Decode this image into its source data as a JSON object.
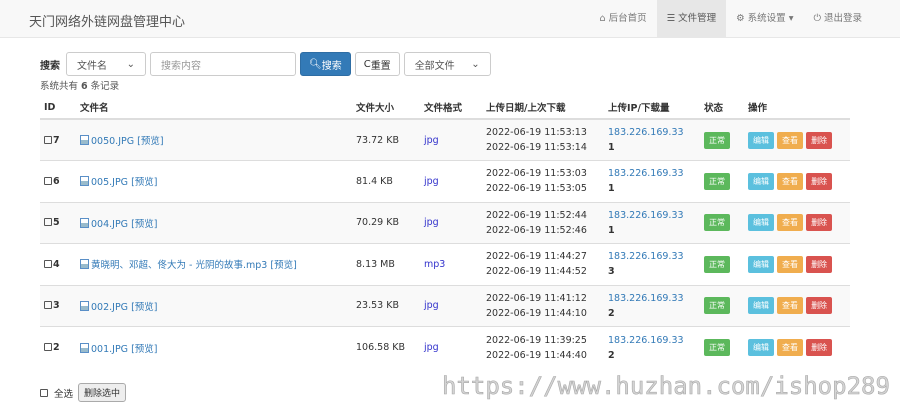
{
  "header": {
    "brand": "天门网络外链网盘管理中心",
    "nav": [
      {
        "label": "后台首页",
        "icon": "home-icon"
      },
      {
        "label": "文件管理",
        "icon": "list-icon",
        "active": true
      },
      {
        "label": "系统设置",
        "icon": "gear-icon",
        "dropdown": true
      },
      {
        "label": "退出登录",
        "icon": "power-icon"
      }
    ]
  },
  "search": {
    "label": "搜索",
    "field_select": "文件名",
    "placeholder": "搜索内容",
    "search_btn": "搜索",
    "reset_btn": "重置",
    "type_select": "全部文件"
  },
  "count": {
    "prefix": "系统共有",
    "num": "6",
    "suffix": "条记录"
  },
  "columns": [
    "ID",
    "文件名",
    "文件大小",
    "文件格式",
    "上传日期/上次下载",
    "上传IP/下载量",
    "状态",
    "操作"
  ],
  "rows": [
    {
      "id": "7",
      "name": "0050.JPG",
      "preview": "[预览]",
      "size": "73.72 KB",
      "fmt": "jpg",
      "up": "2022-06-19 11:53:13",
      "last": "2022-06-19 11:53:14",
      "ip": "183.226.169.33",
      "dl": "1",
      "status": "正常"
    },
    {
      "id": "6",
      "name": "005.JPG",
      "preview": "[预览]",
      "size": "81.4 KB",
      "fmt": "jpg",
      "up": "2022-06-19 11:53:03",
      "last": "2022-06-19 11:53:05",
      "ip": "183.226.169.33",
      "dl": "1",
      "status": "正常"
    },
    {
      "id": "5",
      "name": "004.JPG",
      "preview": "[预览]",
      "size": "70.29 KB",
      "fmt": "jpg",
      "up": "2022-06-19 11:52:44",
      "last": "2022-06-19 11:52:46",
      "ip": "183.226.169.33",
      "dl": "1",
      "status": "正常"
    },
    {
      "id": "4",
      "name": "黄晓明、邓超、佟大为 - 光阴的故事.mp3",
      "preview": "[预览]",
      "size": "8.13 MB",
      "fmt": "mp3",
      "up": "2022-06-19 11:44:27",
      "last": "2022-06-19 11:44:52",
      "ip": "183.226.169.33",
      "dl": "3",
      "status": "正常"
    },
    {
      "id": "3",
      "name": "002.JPG",
      "preview": "[预览]",
      "size": "23.53 KB",
      "fmt": "jpg",
      "up": "2022-06-19 11:41:12",
      "last": "2022-06-19 11:44:10",
      "ip": "183.226.169.33",
      "dl": "2",
      "status": "正常"
    },
    {
      "id": "2",
      "name": "001.JPG",
      "preview": "[预览]",
      "size": "106.58 KB",
      "fmt": "jpg",
      "up": "2022-06-19 11:39:25",
      "last": "2022-06-19 11:44:40",
      "ip": "183.226.169.33",
      "dl": "2",
      "status": "正常"
    }
  ],
  "actions": {
    "edit": "编辑",
    "view": "查看",
    "delete": "删除"
  },
  "footer": {
    "select_all": "全选",
    "delete_selected": "删除选中"
  },
  "watermark": "https://www.huzhan.com/ishop289"
}
